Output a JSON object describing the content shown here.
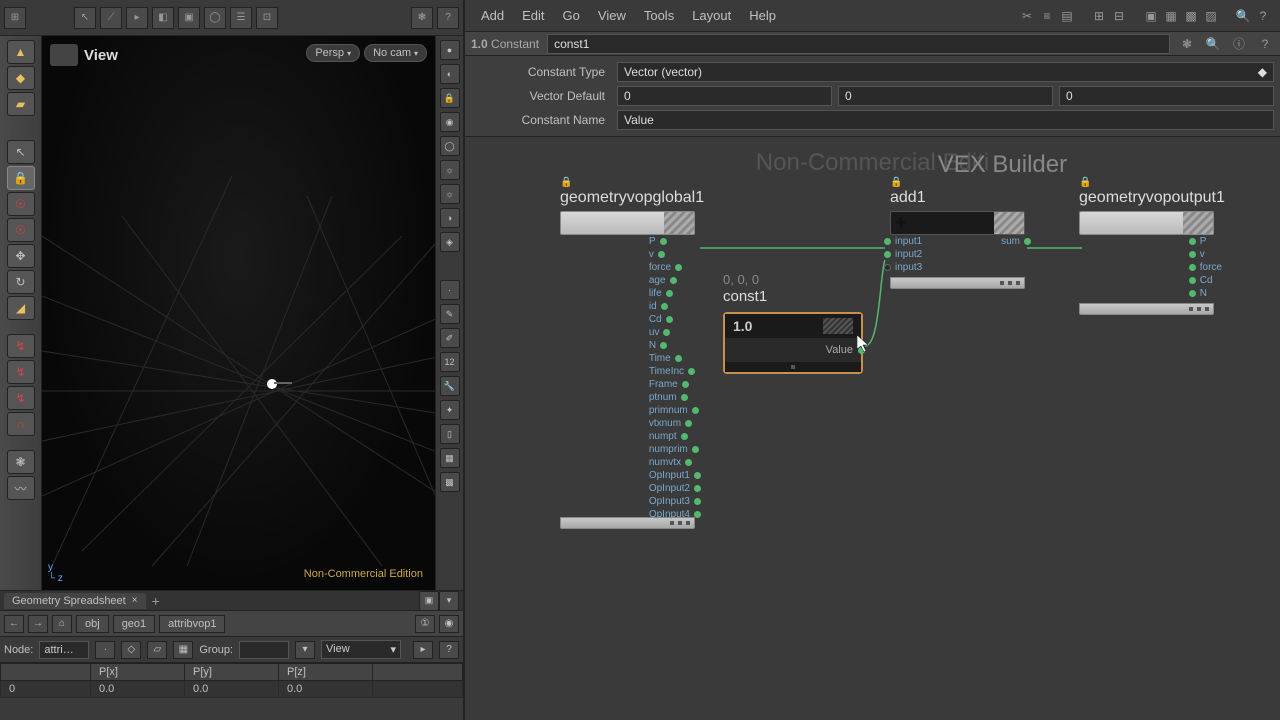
{
  "top_toolbar_left_icons": [
    "⊞"
  ],
  "menu": [
    "Add",
    "Edit",
    "Go",
    "View",
    "Tools",
    "Layout",
    "Help"
  ],
  "view": {
    "label": "View",
    "persp": "Persp",
    "nocam": "No cam",
    "nce": "Non-Commercial Edition"
  },
  "node_inspector": {
    "type_prefix": "1.0",
    "type": "Constant",
    "name": "const1",
    "params": {
      "constant_type_label": "Constant Type",
      "constant_type_value": "Vector (vector)",
      "default_label": "Vector Default",
      "default_x": "0",
      "default_y": "0",
      "default_z": "0",
      "name_label": "Constant Name",
      "name_value": "Value"
    }
  },
  "network": {
    "watermark1": "Non-Commercial Editi",
    "watermark2": "VEX Builder",
    "nodes": {
      "global": {
        "title": "geometryvopglobal1",
        "outputs": [
          "P",
          "v",
          "force",
          "age",
          "life",
          "id",
          "Cd",
          "uv",
          "N",
          "Time",
          "TimeInc",
          "Frame",
          "ptnum",
          "primnum",
          "vtxnum",
          "numpt",
          "numprim",
          "numvtx",
          "OpInput1",
          "OpInput2",
          "OpInput3",
          "OpInput4"
        ]
      },
      "const": {
        "sub": "0, 0, 0",
        "title": "const1",
        "chip": "1.0",
        "out": "Value"
      },
      "add": {
        "title": "add1",
        "inputs": [
          "input1",
          "input2",
          "input3"
        ],
        "outputs": [
          "sum"
        ]
      },
      "output": {
        "title": "geometryvopoutput1",
        "inputs": [
          "P",
          "v",
          "force",
          "Cd",
          "N"
        ]
      }
    }
  },
  "spreadsheet": {
    "tab": "Geometry Spreadsheet",
    "crumbs": [
      "obj",
      "geo1",
      "attribvop1"
    ],
    "node_label": "Node:",
    "node_value": "attri…",
    "group_label": "Group:",
    "view_sel": "View",
    "headers": [
      "",
      "P[x]",
      "P[y]",
      "P[z]"
    ],
    "rows": [
      [
        "0",
        "0.0",
        "0.0",
        "0.0"
      ]
    ]
  }
}
